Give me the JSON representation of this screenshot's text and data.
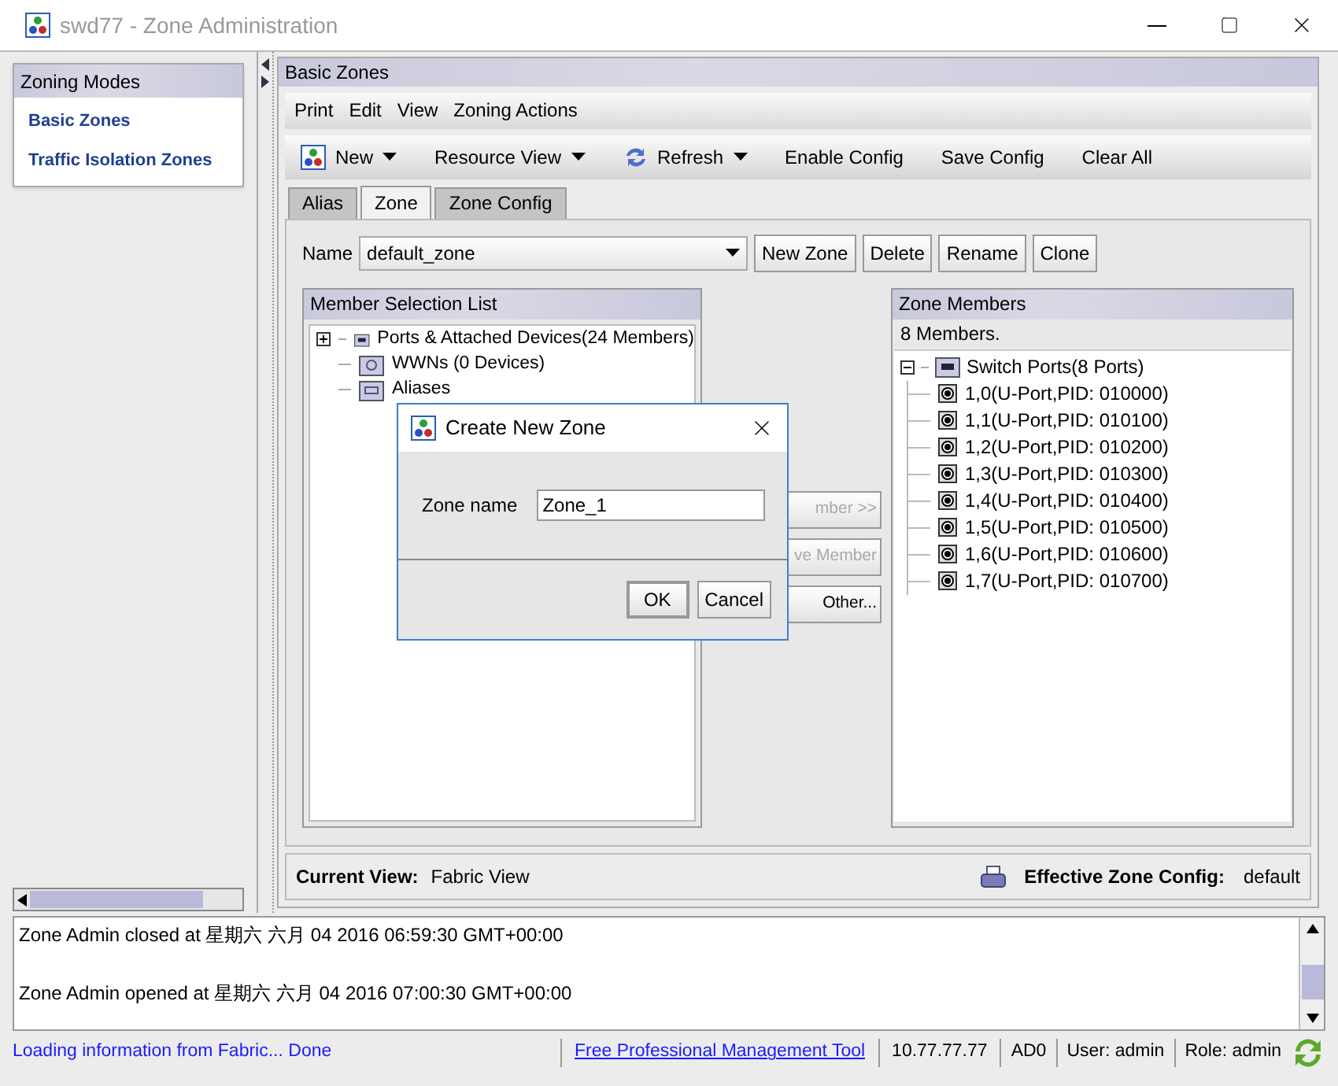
{
  "window": {
    "title": "swd77 - Zone Administration"
  },
  "sidebar": {
    "title": "Zoning Modes",
    "items": [
      {
        "label": "Basic Zones"
      },
      {
        "label": "Traffic Isolation Zones"
      }
    ]
  },
  "panel": {
    "title": "Basic Zones"
  },
  "menu": [
    {
      "label": "Print"
    },
    {
      "label": "Edit"
    },
    {
      "label": "View"
    },
    {
      "label": "Zoning Actions"
    }
  ],
  "toolbar": [
    {
      "label": "New",
      "kind": "dropdown"
    },
    {
      "label": "Resource View",
      "kind": "dropdown"
    },
    {
      "label": "Refresh",
      "kind": "dropdown"
    },
    {
      "label": "Enable Config",
      "kind": "plain"
    },
    {
      "label": "Save Config",
      "kind": "plain"
    },
    {
      "label": "Clear All",
      "kind": "plain"
    }
  ],
  "tabs": [
    {
      "label": "Alias",
      "selected": false
    },
    {
      "label": "Zone",
      "selected": true
    },
    {
      "label": "Zone Config",
      "selected": false
    }
  ],
  "zone_form": {
    "name_label": "Name",
    "name_value": "default_zone",
    "buttons": [
      "New Zone",
      "Delete",
      "Rename",
      "Clone"
    ]
  },
  "member_selection": {
    "title": "Member Selection List",
    "tree": [
      {
        "label": "Ports & Attached Devices(24 Members)",
        "kind": "ports",
        "expanded": false
      },
      {
        "label": "WWNs (0 Devices)",
        "kind": "wwn"
      },
      {
        "label": "Aliases",
        "kind": "alias"
      }
    ]
  },
  "middle_buttons": [
    {
      "label": "mber >>",
      "disabled": true
    },
    {
      "label": "ve Member",
      "disabled": true
    },
    {
      "label": "Other...",
      "disabled": false
    }
  ],
  "zone_members": {
    "title": "Zone Members",
    "count": "8 Members.",
    "tree": [
      {
        "label": "Switch Ports(8 Ports)",
        "expanded": true,
        "children": [
          {
            "label": "1,0(U-Port,PID: 010000)"
          },
          {
            "label": "1,1(U-Port,PID: 010100)"
          },
          {
            "label": "1,2(U-Port,PID: 010200)"
          },
          {
            "label": "1,3(U-Port,PID: 010300)"
          },
          {
            "label": "1,4(U-Port,PID: 010400)"
          },
          {
            "label": "1,5(U-Port,PID: 010500)"
          },
          {
            "label": "1,6(U-Port,PID: 010600)"
          },
          {
            "label": "1,7(U-Port,PID: 010700)"
          }
        ]
      }
    ]
  },
  "footer": {
    "current_view_label": "Current View:",
    "current_view": "Fabric View",
    "effective_label": "Effective Zone Config:",
    "effective": "default"
  },
  "log": [
    "Zone Admin closed at 星期六 六月 04 2016 06:59:30 GMT+00:00",
    "Zone Admin opened at 星期六 六月 04 2016 07:00:30 GMT+00:00"
  ],
  "status_bar": {
    "message": "Loading information from Fabric... Done",
    "link": "Free Professional Management Tool",
    "ip": "10.77.77.77",
    "domain": "AD0",
    "user": "User: admin",
    "role": "Role: admin"
  },
  "dialog": {
    "title": "Create New Zone",
    "field_label": "Zone name",
    "field_value": "Zone_1",
    "buttons": [
      {
        "label": "OK",
        "default": true
      },
      {
        "label": "Cancel",
        "default": false
      }
    ]
  }
}
